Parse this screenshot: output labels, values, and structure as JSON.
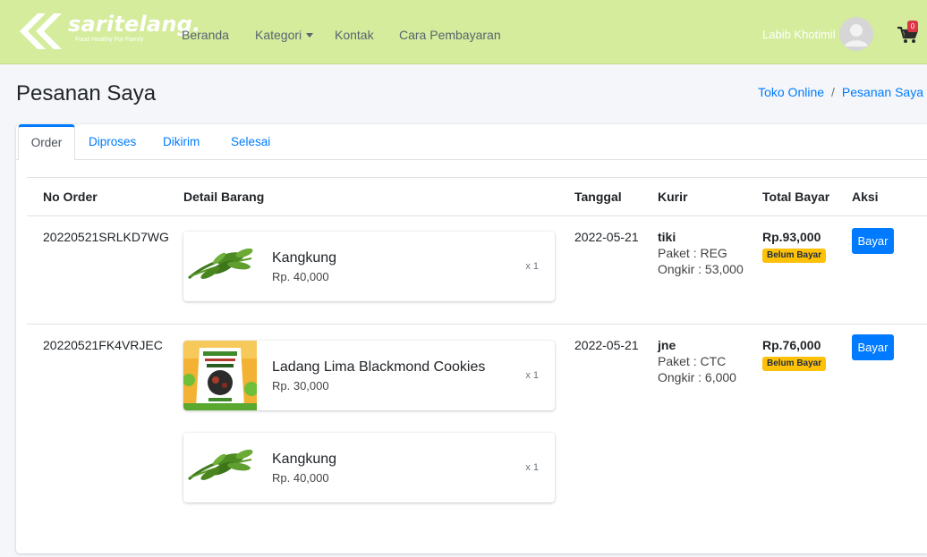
{
  "navbar": {
    "brand_name": "saritelang.",
    "brand_tagline": "Food Healthy For Family",
    "links": [
      "Beranda",
      "Kategori",
      "Kontak",
      "Cara Pembayaran"
    ],
    "user_name": "Labib Khotimil",
    "cart_count": "0",
    "bg_color": "#d4ec9c"
  },
  "header": {
    "title": "Pesanan Saya",
    "breadcrumb": [
      "Toko Online",
      "Pesanan Saya"
    ]
  },
  "tabs": [
    "Order",
    "Diproses",
    "Dikirim",
    "Selesai"
  ],
  "table": {
    "headers": [
      "No Order",
      "Detail Barang",
      "Tanggal",
      "Kurir",
      "Total Bayar",
      "Aksi"
    ],
    "orders": [
      {
        "no_order": "20220521SRLKD7WG",
        "tanggal": "2022-05-21",
        "kurir": "tiki",
        "paket": "Paket : REG",
        "ongkir": "Ongkir : 53,000",
        "total": "Rp.93,000",
        "status": "Belum Bayar",
        "action": "Bayar",
        "items": [
          {
            "name": "Kangkung",
            "price": "Rp. 40,000",
            "qty": "x 1",
            "image": "kangkung"
          }
        ]
      },
      {
        "no_order": "20220521FK4VRJEC",
        "tanggal": "2022-05-21",
        "kurir": "jne",
        "paket": "Paket : CTC",
        "ongkir": "Ongkir : 6,000",
        "total": "Rp.76,000",
        "status": "Belum Bayar",
        "action": "Bayar",
        "items": [
          {
            "name": "Ladang Lima Blackmond Cookies",
            "price": "Rp. 30,000",
            "qty": "x 1",
            "image": "cookies-package"
          },
          {
            "name": "Kangkung",
            "price": "Rp. 40,000",
            "qty": "x 1",
            "image": "kangkung"
          }
        ]
      }
    ]
  },
  "colors": {
    "primary": "#007bff",
    "warning": "#ffc107",
    "danger": "#dc3545"
  }
}
